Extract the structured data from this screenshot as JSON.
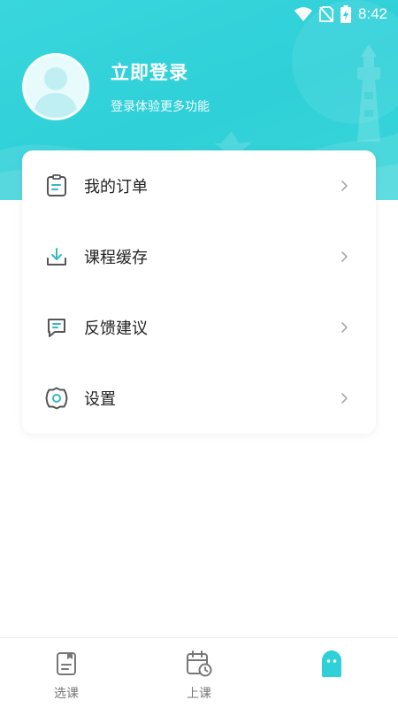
{
  "status_bar": {
    "time": "8:42",
    "icons": [
      "wifi-icon",
      "no-sim-icon",
      "battery-charging-icon"
    ]
  },
  "profile": {
    "title": "立即登录",
    "subtitle": "登录体验更多功能"
  },
  "menu": [
    {
      "label": "我的订单",
      "icon": "order-icon"
    },
    {
      "label": "课程缓存",
      "icon": "download-icon"
    },
    {
      "label": "反馈建议",
      "icon": "feedback-icon"
    },
    {
      "label": "设置",
      "icon": "gear-icon"
    }
  ],
  "tabs": [
    {
      "label": "选课",
      "icon": "course-book-icon"
    },
    {
      "label": "上课",
      "icon": "calendar-clock-icon"
    },
    {
      "label": "",
      "icon": "profile-face-icon",
      "active": true
    }
  ],
  "colors": {
    "accent": "#2fd0d8",
    "icon_teal": "#36b9bf",
    "icon_gray": "#555555",
    "text": "#222222"
  }
}
